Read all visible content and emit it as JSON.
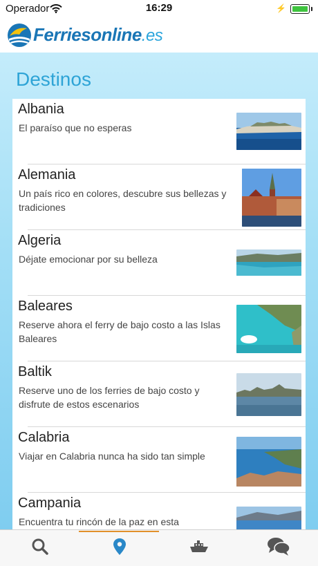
{
  "status_bar": {
    "carrier": "Operador",
    "time": "16:29"
  },
  "brand": {
    "name": "Ferriesonline",
    "tld": ".es"
  },
  "page": {
    "title": "Destinos"
  },
  "destinations": [
    {
      "name": "Albania",
      "description": "El paraíso que no esperas"
    },
    {
      "name": "Alemania",
      "description": "Un país rico en colores, descubre sus bellezas y tradiciones"
    },
    {
      "name": "Algeria",
      "description": "Déjate emocionar por su belleza"
    },
    {
      "name": "Baleares",
      "description": "Reserve ahora el ferry de bajo costo a las Islas Baleares"
    },
    {
      "name": "Baltik",
      "description": "Reserve uno de los ferries de bajo costo y disfrute de estos escenarios"
    },
    {
      "name": "Calabria",
      "description": "Viajar en Calabria nunca ha sido tan simple"
    },
    {
      "name": "Campania",
      "description": "Encuentra tu rincón de la paz en esta"
    }
  ],
  "tabs": [
    {
      "icon": "search-icon",
      "active": false
    },
    {
      "icon": "location-pin-icon",
      "active": true
    },
    {
      "icon": "ferry-icon",
      "active": false
    },
    {
      "icon": "chat-bubbles-icon",
      "active": false
    }
  ],
  "colors": {
    "brand": "#1a76b6",
    "accent": "#2ea4d6",
    "tab_active": "#2a88c8",
    "tab_inactive": "#555555",
    "active_underline": "#e2902a"
  }
}
